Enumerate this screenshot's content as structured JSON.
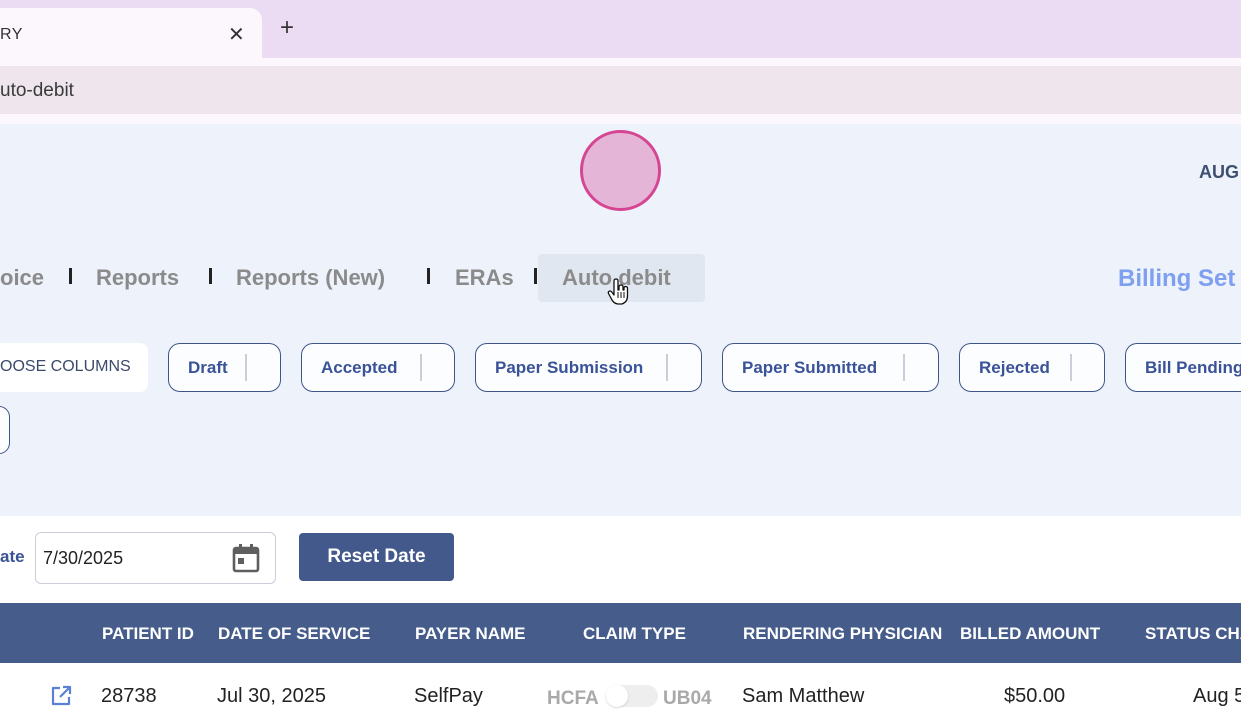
{
  "browser": {
    "tab_title": "RY",
    "close_glyph": "✕",
    "new_tab_glyph": "+",
    "url": "uto-debit"
  },
  "header": {
    "month_label": "AUG"
  },
  "nav": {
    "items": [
      {
        "label": "oice"
      },
      {
        "label": "Reports"
      },
      {
        "label": "Reports (New)"
      },
      {
        "label": "ERAs"
      },
      {
        "label": "Auto debit"
      }
    ],
    "right_link": "Billing Set"
  },
  "filters": {
    "choose_columns": "OOSE COLUMNS",
    "chips": [
      {
        "label": "Draft"
      },
      {
        "label": "Accepted"
      },
      {
        "label": "Paper Submission"
      },
      {
        "label": "Paper Submitted"
      },
      {
        "label": "Rejected"
      },
      {
        "label": "Bill Pending"
      }
    ]
  },
  "date_filter": {
    "label": "ate",
    "value": "7/30/2025",
    "reset_label": "Reset Date"
  },
  "table": {
    "headers": [
      "PATIENT ID",
      "DATE OF SERVICE",
      "PAYER NAME",
      "CLAIM TYPE",
      "RENDERING PHYSICIAN",
      "BILLED AMOUNT",
      "STATUS CHA"
    ],
    "rows": [
      {
        "patient_id": "28738",
        "date_of_service": "Jul 30, 2025",
        "payer_name": "SelfPay",
        "claim_type_left": "HCFA",
        "claim_type_right": "UB04",
        "physician": "Sam Matthew",
        "billed_amount": "$50.00",
        "status_changed": "Aug 5"
      }
    ]
  },
  "icons": {
    "close": "close-icon",
    "calendar": "calendar-icon",
    "external_link": "external-link-icon",
    "hand_cursor": "hand-cursor-icon"
  },
  "colors": {
    "header_bg": "#465d8c",
    "button_bg": "#44598b",
    "chip_text": "#3a5398",
    "billing_link": "#7f9ff0",
    "app_bg": "#edf2fb",
    "highlight_ring": "#d54593"
  }
}
